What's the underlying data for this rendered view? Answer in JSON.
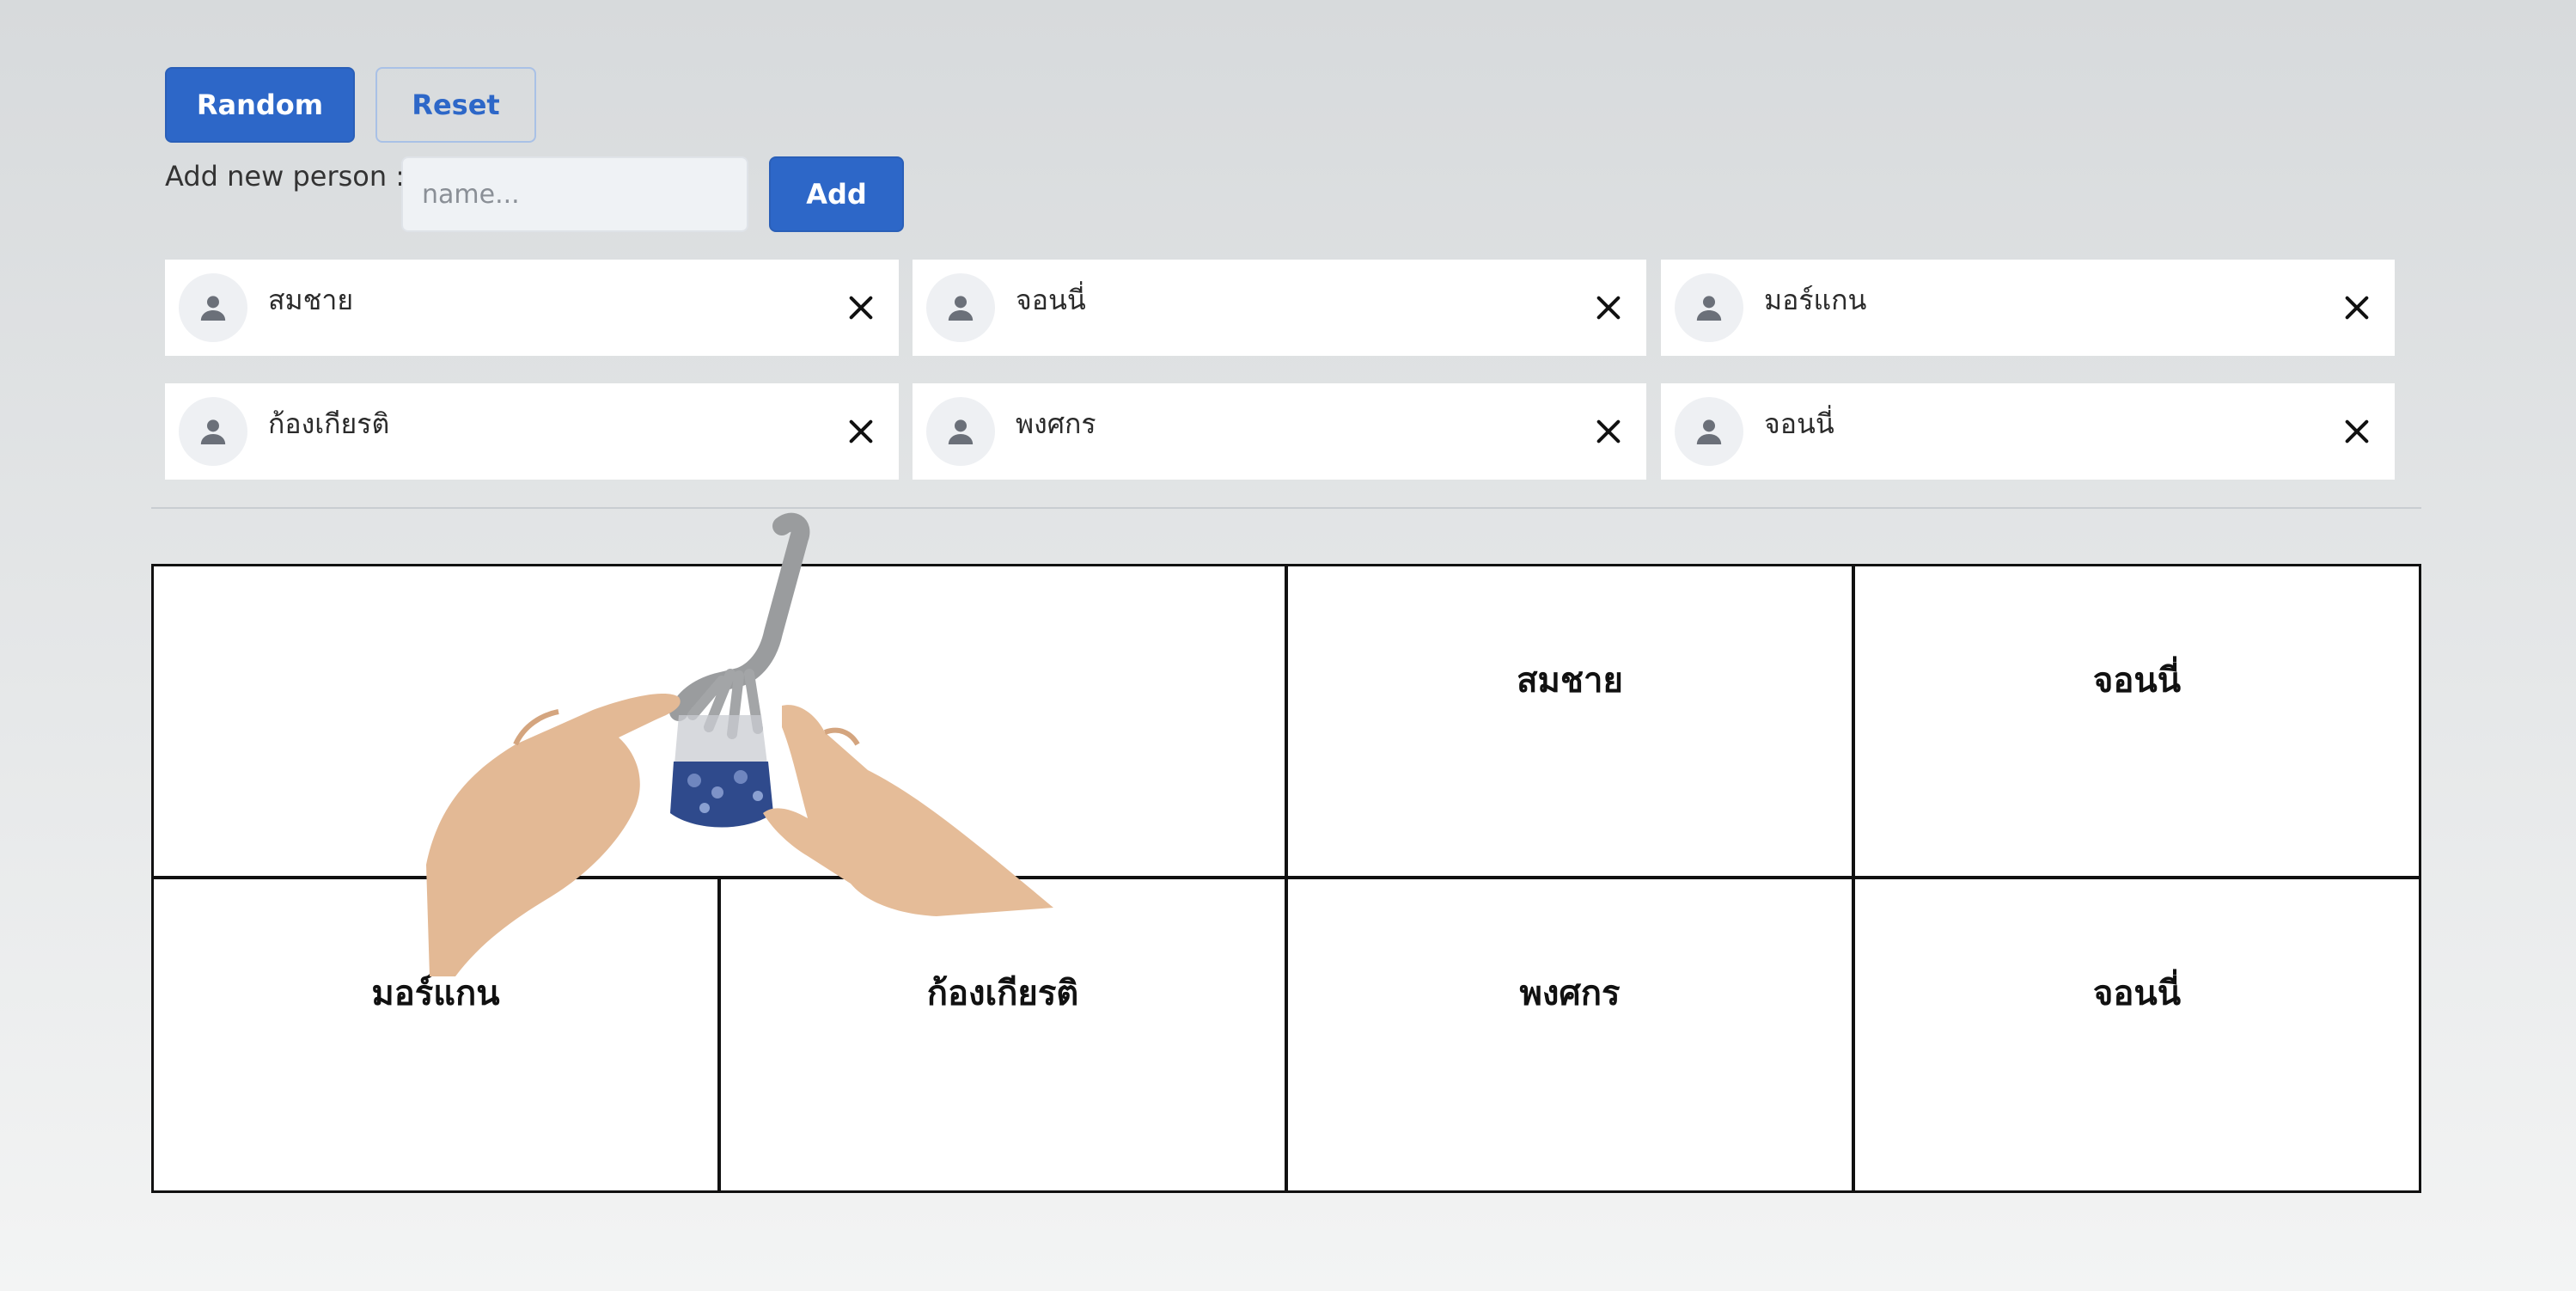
{
  "controls": {
    "random_label": "Random",
    "reset_label": "Reset",
    "add_person_label": "Add new person :",
    "name_placeholder": "name...",
    "add_label": "Add"
  },
  "people": [
    {
      "name": "สมชาย",
      "icon": "user-icon",
      "remove_icon": "close-icon"
    },
    {
      "name": "จอนนี่",
      "icon": "user-icon",
      "remove_icon": "close-icon"
    },
    {
      "name": "มอร์แกน",
      "icon": "user-icon",
      "remove_icon": "close-icon"
    },
    {
      "name": "ก้องเกียรติ",
      "icon": "user-icon",
      "remove_icon": "close-icon"
    },
    {
      "name": "พงศกร",
      "icon": "user-icon",
      "remove_icon": "close-icon"
    },
    {
      "name": "จอนนี่",
      "icon": "user-icon",
      "remove_icon": "close-icon"
    }
  ],
  "seating": {
    "cells": [
      {
        "name": ""
      },
      {
        "name": "สมชาย"
      },
      {
        "name": "จอนนี่"
      },
      {
        "name": "มอร์แกน"
      },
      {
        "name": "ก้องเกียรติ"
      },
      {
        "name": "พงศกร"
      },
      {
        "name": "จอนนี่"
      }
    ]
  },
  "colors": {
    "primary": "#2d67c8",
    "background": "#d7dadc",
    "card": "#ffffff"
  }
}
